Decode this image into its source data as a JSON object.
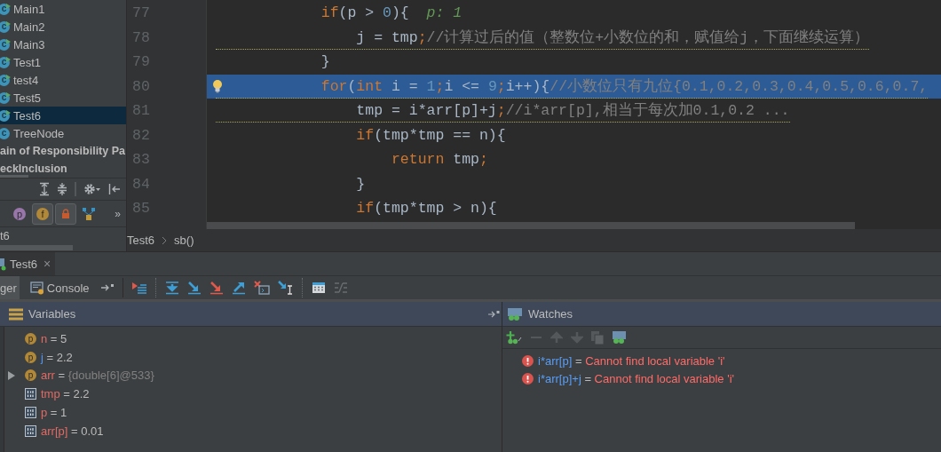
{
  "project_tree": {
    "items": [
      {
        "label": "Main1",
        "kind": "class",
        "icon": "c",
        "runnable": true,
        "selected": false
      },
      {
        "label": "Main2",
        "kind": "class",
        "icon": "c",
        "runnable": true,
        "selected": false
      },
      {
        "label": "Main3",
        "kind": "class",
        "icon": "c",
        "runnable": true,
        "selected": false
      },
      {
        "label": "Test1",
        "kind": "class",
        "icon": "c",
        "runnable": true,
        "selected": false
      },
      {
        "label": "test4",
        "kind": "class",
        "icon": "c",
        "runnable": true,
        "selected": false
      },
      {
        "label": "Test5",
        "kind": "class",
        "icon": "c",
        "runnable": true,
        "selected": false
      },
      {
        "label": "Test6",
        "kind": "class",
        "icon": "c",
        "runnable": true,
        "selected": true
      },
      {
        "label": "TreeNode",
        "kind": "class",
        "icon": "c",
        "runnable": false,
        "selected": false
      },
      {
        "label": "ain of Responsibility Pa",
        "kind": "package",
        "selected": false
      },
      {
        "label": "eckInclusion",
        "kind": "package",
        "selected": false
      }
    ]
  },
  "structure_toolbar": {
    "filters": [
      {
        "kind": "letter",
        "icon": "p",
        "color": "#9876aa",
        "selected": false
      },
      {
        "kind": "letter",
        "icon": "f",
        "color": "#b08838",
        "selected": true
      },
      {
        "kind": "lock",
        "selected": true
      },
      {
        "kind": "hierarchy",
        "selected": false
      }
    ],
    "more": "»"
  },
  "structure_tab": {
    "label": "t6"
  },
  "editor": {
    "lines": [
      {
        "number": "77",
        "current": false,
        "warning": false,
        "tokens": [
          {
            "kind": "keyword",
            "text": "            if"
          },
          {
            "kind": "plain",
            "text": "(p > "
          },
          {
            "kind": "number",
            "text": "0"
          },
          {
            "kind": "plain",
            "text": "){  "
          },
          {
            "kind": "hint",
            "text": "p: 1"
          }
        ]
      },
      {
        "number": "78",
        "current": false,
        "warning": true,
        "tokens": [
          {
            "kind": "plain",
            "text": "                j = tmp"
          },
          {
            "kind": "keyword",
            "text": ";"
          },
          {
            "kind": "comment",
            "text": "//计算过后的值（整数位+小数位的和，赋值给j，下面继续运算）"
          }
        ]
      },
      {
        "number": "79",
        "current": false,
        "warning": false,
        "tokens": [
          {
            "kind": "plain",
            "text": "            }"
          }
        ]
      },
      {
        "number": "80",
        "current": true,
        "warning": true,
        "tokens": [
          {
            "kind": "keyword",
            "text": "            for"
          },
          {
            "kind": "plain",
            "text": "("
          },
          {
            "kind": "keyword",
            "text": "int"
          },
          {
            "kind": "plain",
            "text": " i = "
          },
          {
            "kind": "number",
            "text": "1"
          },
          {
            "kind": "keyword",
            "text": ";"
          },
          {
            "kind": "plain",
            "text": "i <= "
          },
          {
            "kind": "number",
            "text": "9"
          },
          {
            "kind": "keyword",
            "text": ";"
          },
          {
            "kind": "plain",
            "text": "i++){"
          },
          {
            "kind": "comment",
            "text": "//小数位只有九位{0.1,0.2,0.3,0.4,0.5,0.6,0.7,"
          }
        ]
      },
      {
        "number": "81",
        "current": false,
        "warning": true,
        "tokens": [
          {
            "kind": "plain",
            "text": "                tmp = i*arr[p]+j"
          },
          {
            "kind": "keyword",
            "text": ";"
          },
          {
            "kind": "comment",
            "text": "//i*arr[p],相当于每次加0.1,0.2 ..."
          }
        ]
      },
      {
        "number": "82",
        "current": false,
        "warning": false,
        "tokens": [
          {
            "kind": "keyword",
            "text": "                if"
          },
          {
            "kind": "plain",
            "text": "(tmp*tmp == n){"
          }
        ]
      },
      {
        "number": "83",
        "current": false,
        "warning": false,
        "tokens": [
          {
            "kind": "keyword",
            "text": "                    return"
          },
          {
            "kind": "plain",
            "text": " tmp"
          },
          {
            "kind": "keyword",
            "text": ";"
          }
        ]
      },
      {
        "number": "84",
        "current": false,
        "warning": false,
        "tokens": [
          {
            "kind": "plain",
            "text": "                }"
          }
        ]
      },
      {
        "number": "85",
        "current": false,
        "warning": false,
        "tokens": [
          {
            "kind": "keyword",
            "text": "                if"
          },
          {
            "kind": "plain",
            "text": "(tmp*tmp > n){"
          }
        ]
      }
    ],
    "breadcrumbs": [
      "Test6",
      "sb()"
    ]
  },
  "debug_tab": {
    "label": "Test6",
    "close": "×"
  },
  "debug_toolbar": {
    "tabs": [
      {
        "label": "ger",
        "selected": true
      },
      {
        "label": "Console",
        "selected": false
      }
    ]
  },
  "variables": {
    "title": "Variables",
    "items": [
      {
        "kind": "parameter",
        "icon": "p",
        "name": "n",
        "sign": "=",
        "value": "5",
        "changed": false,
        "expandable": false
      },
      {
        "kind": "parameter",
        "icon": "p",
        "name": "j",
        "sign": "=",
        "value": "2.2",
        "changed": true,
        "expandable": false
      },
      {
        "kind": "parameter",
        "icon": "p",
        "name": "arr",
        "sign": "=",
        "value": "{double[6]@533}",
        "changed": false,
        "expandable": true
      },
      {
        "kind": "local",
        "name": "tmp",
        "sign": "=",
        "value": "2.2",
        "changed": false,
        "expandable": false
      },
      {
        "kind": "local",
        "name": "p",
        "sign": "=",
        "value": "1",
        "changed": false,
        "expandable": false
      },
      {
        "kind": "local",
        "name": "arr[p]",
        "sign": "=",
        "value": "0.01",
        "changed": false,
        "expandable": false
      }
    ]
  },
  "watches": {
    "title": "Watches",
    "items": [
      {
        "expression": "i*arr[p]",
        "sign": "=",
        "message": "Cannot find local variable 'i'",
        "error": true
      },
      {
        "expression": "i*arr[p]+j",
        "sign": "=",
        "message": "Cannot find local variable 'i'",
        "error": true
      }
    ]
  }
}
